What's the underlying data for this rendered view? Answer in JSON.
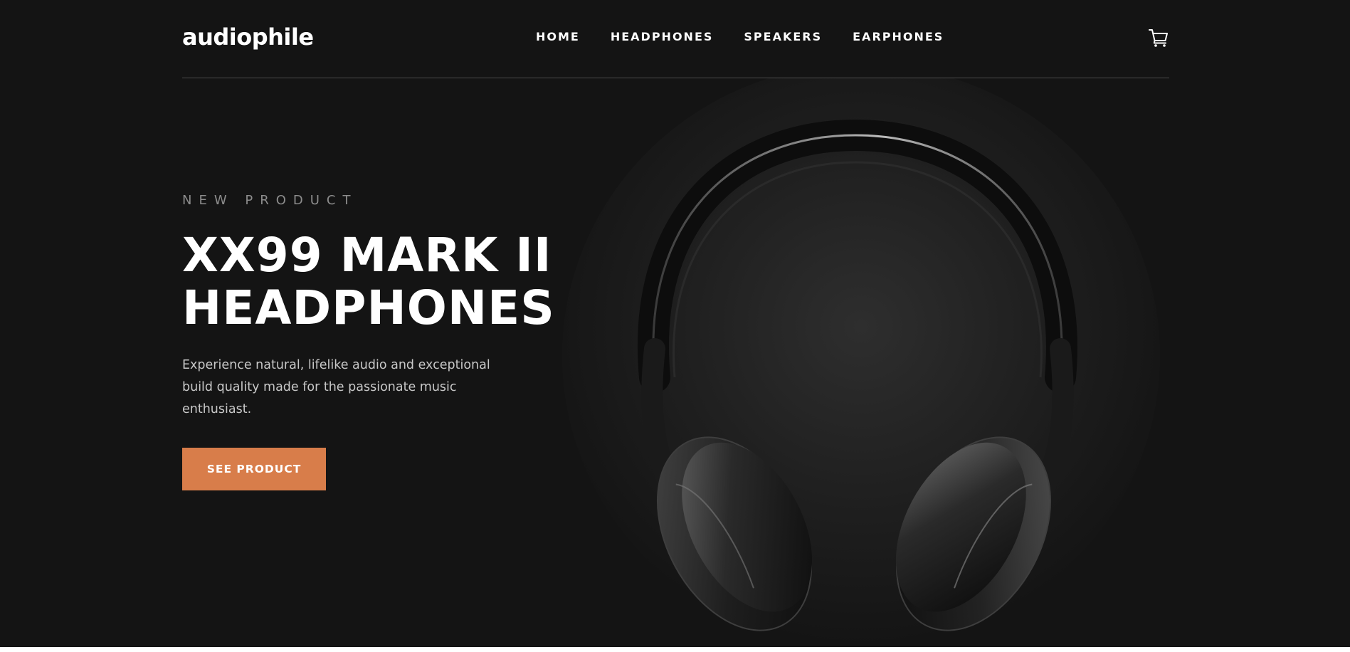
{
  "header": {
    "logo": "audiophile",
    "nav": [
      {
        "label": "HOME"
      },
      {
        "label": "HEADPHONES"
      },
      {
        "label": "SPEAKERS"
      },
      {
        "label": "EARPHONES"
      }
    ],
    "cart_icon": "cart-icon"
  },
  "hero": {
    "eyebrow": "NEW PRODUCT",
    "title_line1": "XX99 MARK II",
    "title_line2": "HEADPHONES",
    "description": "Experience natural, lifelike audio and exceptional build quality made for the passionate music enthusiast.",
    "cta_label": "SEE PRODUCT",
    "image": "headphones-image"
  },
  "colors": {
    "background": "#141414",
    "accent": "#d87d4a",
    "text": "#ffffff",
    "muted": "#8c8c8c"
  }
}
